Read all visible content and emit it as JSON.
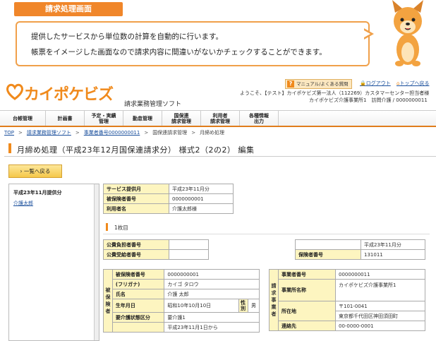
{
  "callout": {
    "tab": "請求処理画面",
    "line1": "提供したサービスから単位数の計算を自動的に行います。",
    "line2": "帳票をイメージした画面なので請求内容に間違いがないかチェックすることができます。"
  },
  "header": {
    "logo": "カイポケビズ",
    "subtitle": "請求業務管理ソフト",
    "help_label": "マニュアル/よくある質問",
    "logout_label": "ログアウト",
    "top_label": "トップへ戻る",
    "welcome": "ようこそ、【テスト】カイポケビズ第一法人（112269）カスタマーセンター担当者様",
    "office": "カイポケビズ介護事業所1　訪問介護 / 0000000011"
  },
  "nav": {
    "items": [
      "台帳管理",
      "計画書",
      "予定・実績\n管理",
      "勤怠管理",
      "国保連\n請求管理",
      "利用者\n請求管理",
      "各種情報\n出力"
    ]
  },
  "breadcrumb": {
    "items": [
      "TOP",
      "請求業務管理ソフト",
      "事業者番号0000000011",
      "国保連請求管理",
      "月締め処理"
    ],
    "sep": ">"
  },
  "page": {
    "title": "月締め処理（平成23年12月国保連請求分） 様式2（2の2） 編集",
    "back_label": "一覧へ戻る"
  },
  "left_panel": {
    "month": "平成23年11月提供分",
    "user": "介護太郎"
  },
  "summary": {
    "service_month_label": "サービス提供月",
    "service_month": "平成23年11月分",
    "insured_no_label": "被保険者番号",
    "insured_no": "0000000001",
    "user_name_label": "利用者名",
    "user_name": "介護太郎様"
  },
  "sheet": {
    "label": "1枚目",
    "payer_label": "公費負担者番号",
    "payer_value": "",
    "recipient_label": "公費受給者番号",
    "recipient_value": "",
    "month_value": "平成23年11月分",
    "insurer_label": "保険者番号",
    "insurer_value": "131011"
  },
  "insured": {
    "section": "被保険者",
    "insured_no_label": "被保険者番号",
    "insured_no": "0000000001",
    "kana_label": "(フリガナ)",
    "kana": "カイゴ タロウ",
    "name_label": "氏名",
    "name": "介護 太郎",
    "birth_label": "生年月日",
    "birth": "昭和10年10月10日",
    "sex_label": "性別",
    "sex": "男",
    "care_label": "要介護状態区分",
    "care": "要介護1",
    "period": "平成23年11月1日から"
  },
  "office": {
    "section": "請求事業者",
    "no_label": "事業者番号",
    "no": "0000000011",
    "name_label": "事業所名称",
    "name": "カイポケビズ介護事業所1",
    "addr_label": "所在地",
    "zip": "〒101-0041",
    "addr": "東京都千代田区神田須田町",
    "tel_label": "連絡先",
    "tel": "00-0000-0001"
  },
  "colors": {
    "accent": "#f08a1c",
    "link": "#1a4f9c",
    "label_bg": "#fdf5c0"
  }
}
